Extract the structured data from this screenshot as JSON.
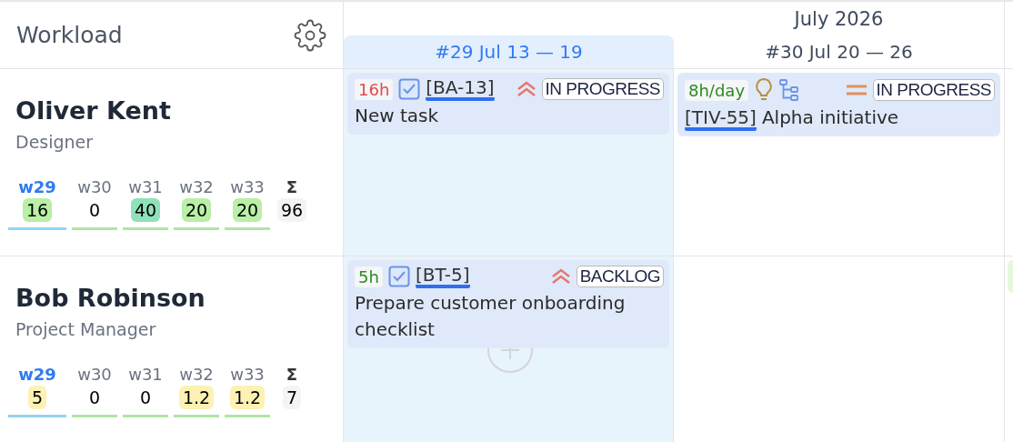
{
  "title": "Workload",
  "month": "July 2026",
  "weeks": [
    {
      "label": "#29 Jul 13 — 19",
      "selected": true
    },
    {
      "label": "#30 Jul 20 — 26",
      "selected": false
    }
  ],
  "people": [
    {
      "name": "Oliver Kent",
      "role": "Designer",
      "stats": [
        {
          "label": "w29",
          "value": "16",
          "selected": true,
          "color": "#b9efa6"
        },
        {
          "label": "w30",
          "value": "0",
          "selected": false
        },
        {
          "label": "w31",
          "value": "40",
          "selected": false,
          "color": "#8fe1b9"
        },
        {
          "label": "w32",
          "value": "20",
          "selected": false,
          "color": "#b9efa6"
        },
        {
          "label": "w33",
          "value": "20",
          "selected": false,
          "color": "#b9efa6"
        }
      ],
      "total_label": "Σ",
      "total": "96",
      "cells": [
        [
          {
            "kind": "task",
            "hours": "16h",
            "color": "#e5484d",
            "key": "[BA-13]",
            "priority": {
              "kind": "high"
            },
            "status": "IN PROGRESS",
            "title": "New task"
          }
        ],
        [
          {
            "kind": "initiative",
            "hours": "8h/day",
            "color": "#2f8a1f",
            "key": "[TIV-55]",
            "priority": {
              "kind": "medium"
            },
            "status": "IN PROGRESS",
            "title": "Alpha initiative"
          }
        ]
      ]
    },
    {
      "name": "Bob Robinson",
      "role": "Project Manager",
      "stats": [
        {
          "label": "w29",
          "value": "5",
          "selected": true,
          "color": "#fdf2b3"
        },
        {
          "label": "w30",
          "value": "0",
          "selected": false
        },
        {
          "label": "w31",
          "value": "0",
          "selected": false
        },
        {
          "label": "w32",
          "value": "1.2",
          "selected": false,
          "color": "#fdf2b3"
        },
        {
          "label": "w33",
          "value": "1.2",
          "selected": false,
          "color": "#fdf2b3"
        }
      ],
      "total_label": "Σ",
      "total": "7",
      "cells": [
        [
          {
            "kind": "task",
            "hours": "5h",
            "color": "#2f8a1f",
            "key": "[BT-5]",
            "priority": {
              "kind": "high"
            },
            "status": "BACKLOG",
            "title": "Prepare customer onboarding checklist"
          }
        ],
        []
      ]
    }
  ]
}
